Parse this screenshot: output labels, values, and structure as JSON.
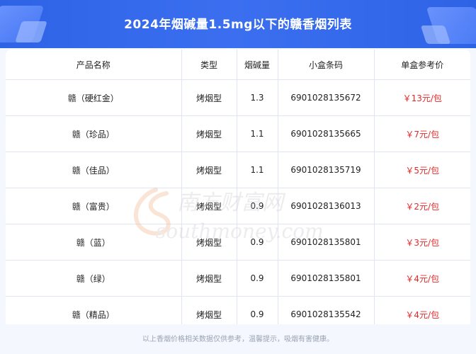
{
  "header": {
    "title": "2024年烟碱量1.5mg以下的赣香烟列表"
  },
  "table": {
    "columns": [
      "产品名称",
      "类型",
      "烟碱量",
      "小盒条码",
      "单盒参考价"
    ],
    "rows": [
      [
        "赣（硬红金）",
        "烤烟型",
        "1.3",
        "6901028135672",
        "￥13元/包"
      ],
      [
        "赣（珍品）",
        "烤烟型",
        "1.1",
        "6901028135665",
        "￥7元/包"
      ],
      [
        "赣（佳品）",
        "烤烟型",
        "1.1",
        "6901028135719",
        "￥5元/包"
      ],
      [
        "赣（富贵）",
        "烤烟型",
        "0.9",
        "6901028136013",
        "￥2元/包"
      ],
      [
        "赣（蓝）",
        "烤烟型",
        "0.9",
        "6901028135801",
        "￥3元/包"
      ],
      [
        "赣（绿）",
        "烤烟型",
        "0.9",
        "6901028135801",
        "￥4元/包"
      ],
      [
        "赣（精品）",
        "烤烟型",
        "0.9",
        "6901028135542",
        "￥4元/包"
      ]
    ]
  },
  "watermark": {
    "cn": "南方财富网",
    "en": "southmoney.com"
  },
  "footer": {
    "note": "以上香烟价格相关数据仅供参考，温馨提示，吸烟有害健康。"
  },
  "colors": {
    "header_bg": "#3b6ff0",
    "price": "#e02a2a"
  }
}
